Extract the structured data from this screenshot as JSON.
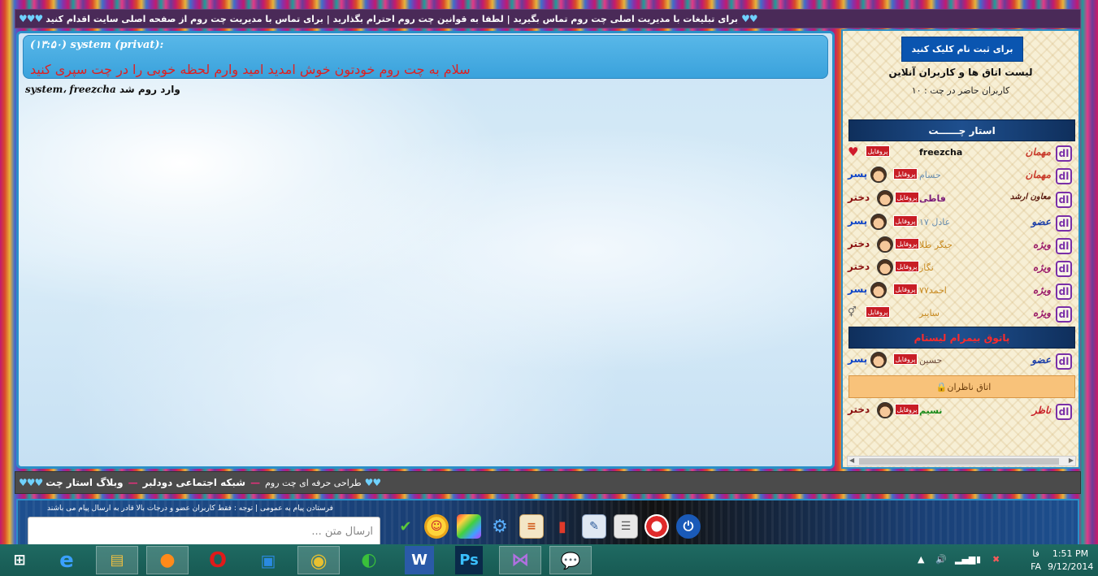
{
  "topbar": {
    "text": "برای تبلیغات با مدیریت اصلی چت روم تماس بگیرید | لطفا به قوانین چت روم احترام بگذارید | برای تماس با مدیریت چت روم از صفحه اصلی سایت اقدام کنید",
    "hearts_left": "♥♥♥",
    "hearts_right": "♥♥"
  },
  "chat": {
    "system_header": "(۱۳:۵۰) system (privat):",
    "system_body": "سلام به چت روم خودتون خوش امدید امید وارم لحظه خوبی را در چت سپری کنید",
    "join_user": "system، freezcha",
    "join_text": "وارد روم شد"
  },
  "sidebar": {
    "register_button": "برای ثبت نام کلیک کنید",
    "list_title": "لیست اتاق ها و کاربران آنلاین",
    "online_count": "کاربران حاضر در چت : ۱۰",
    "rooms": [
      {
        "name": "استار چــــــت",
        "users": [
          {
            "rank": "مهمان",
            "name": "freezcha",
            "profile": "پروفایل",
            "gender": "",
            "marker": "heart"
          },
          {
            "rank": "مهمان",
            "name": "حسام",
            "profile": "پروفایل",
            "gender": "پسر"
          },
          {
            "rank": "معاون ارشد",
            "name": "فاطی",
            "profile": "پروفایل",
            "gender": "دختر"
          },
          {
            "rank": "عضو",
            "name": "عادل ۱۷",
            "profile": "پروفایل",
            "gender": "پسر"
          },
          {
            "rank": "ویژه",
            "name": "جیگر طلا",
            "profile": "پروفایل",
            "gender": "دختر"
          },
          {
            "rank": "ویژه",
            "name": "نگار",
            "profile": "پروفایل",
            "gender": "دختر"
          },
          {
            "rank": "ویژه",
            "name": "احمد۷۷",
            "profile": "پروفایل",
            "gender": "پسر"
          },
          {
            "rank": "ویژه",
            "name": "سایبر",
            "profile": "پروفایل",
            "gender": "⚥"
          }
        ]
      },
      {
        "name": "پاتوق بیمرام لیستام",
        "users": [
          {
            "rank": "عضو",
            "name": "حسین",
            "profile": "پروفایل",
            "gender": "پسر"
          }
        ]
      }
    ],
    "locked_room": "اتاق ناظران",
    "locked_users": [
      {
        "rank": "ناظر",
        "name": "نسیم",
        "profile": "پروفایل",
        "gender": "دختر"
      }
    ]
  },
  "midbar": {
    "hearts_left": "♥♥♥",
    "hearts_right": "♥♥",
    "link1": "طراحی حرفه ای چت روم",
    "link2": "شبکه اجتماعی دودلبر",
    "link3": "وبلاگ استار چت"
  },
  "inputbar": {
    "notice": "فرستادن پیام به عمومی | توجه : فقط کاربران عضو و درجات بالا قادر به ارسال پیام می باشند",
    "placeholder": "ارسال متن ..."
  },
  "taskbar": {
    "time": "1:51 PM",
    "date": "9/12/2014",
    "lang_code": "FA",
    "lang_label": "فا"
  },
  "colors": {
    "accent": "#2b8fc8",
    "register_btn": "#0a55b0",
    "system_text": "#e02020",
    "taskbar": "#1f6a62"
  }
}
